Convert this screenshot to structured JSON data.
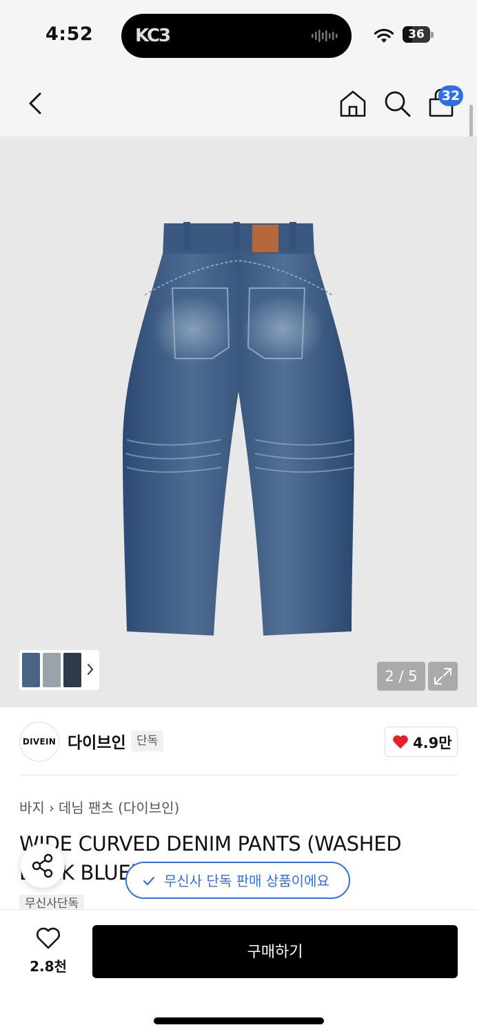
{
  "status_bar": {
    "time": "4:52",
    "island_logo": "KC3",
    "battery": "36",
    "battery_level_percent": 36
  },
  "header": {
    "back_icon": "chevron-left-icon",
    "home_icon": "home-icon",
    "search_icon": "search-icon",
    "cart_icon": "shopping-bag-icon",
    "cart_count": "32",
    "accent_color": "#2f6fe5"
  },
  "gallery": {
    "counter": "2 / 5",
    "expand_icon": "expand-icon",
    "thumbnail_arrow_icon": "chevron-right-icon"
  },
  "brand": {
    "logo_text": "DIVEIN",
    "name": "다이브인",
    "tag": "단독",
    "like_count": "4.9만"
  },
  "product": {
    "breadcrumb": [
      "바지",
      "데님 팬츠 (다이브인)"
    ],
    "title": "WIDE CURVED DENIM PANTS (WASHED DARK BLUE)",
    "badge": "무신사단독",
    "exclusive_pill": "무신사 단독 판매 상품이에요"
  },
  "bottom_bar": {
    "wish_count": "2.8천",
    "buy_label": "구매하기"
  }
}
